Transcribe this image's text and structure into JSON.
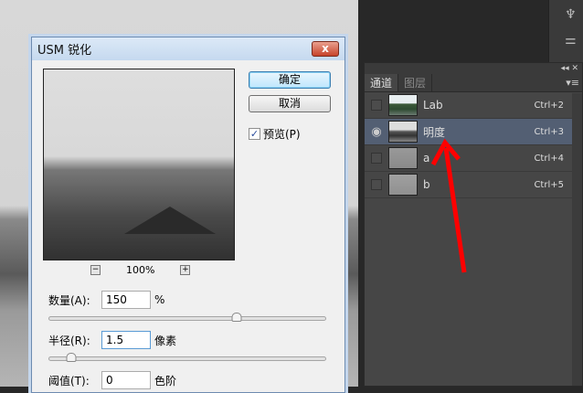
{
  "dialog": {
    "title": "USM 锐化",
    "close_label": "x",
    "ok_label": "确定",
    "cancel_label": "取消",
    "preview_label": "预览(P)",
    "preview_checked": true,
    "zoom_level": "100%",
    "zoom_out": "−",
    "zoom_in": "+",
    "amount": {
      "label": "数量(A):",
      "value": "150",
      "unit": "%",
      "slider_fraction": 0.68
    },
    "radius": {
      "label": "半径(R):",
      "value": "1.5",
      "unit": "像素",
      "slider_fraction": 0.08
    },
    "threshold": {
      "label": "阈值(T):",
      "value": "0",
      "unit": "色阶"
    }
  },
  "panel": {
    "collapse": "◂◂ ✕",
    "tabs": [
      "通道",
      "图层"
    ],
    "menu_icon": "▾≡",
    "channels": [
      {
        "name": "Lab",
        "shortcut": "Ctrl+2",
        "visible": false
      },
      {
        "name": "明度",
        "shortcut": "Ctrl+3",
        "visible": true
      },
      {
        "name": "a",
        "shortcut": "Ctrl+4",
        "visible": false
      },
      {
        "name": "b",
        "shortcut": "Ctrl+5",
        "visible": false
      }
    ]
  },
  "colors": {
    "arrow": "#ff0000",
    "selected_row": "#535f73"
  }
}
